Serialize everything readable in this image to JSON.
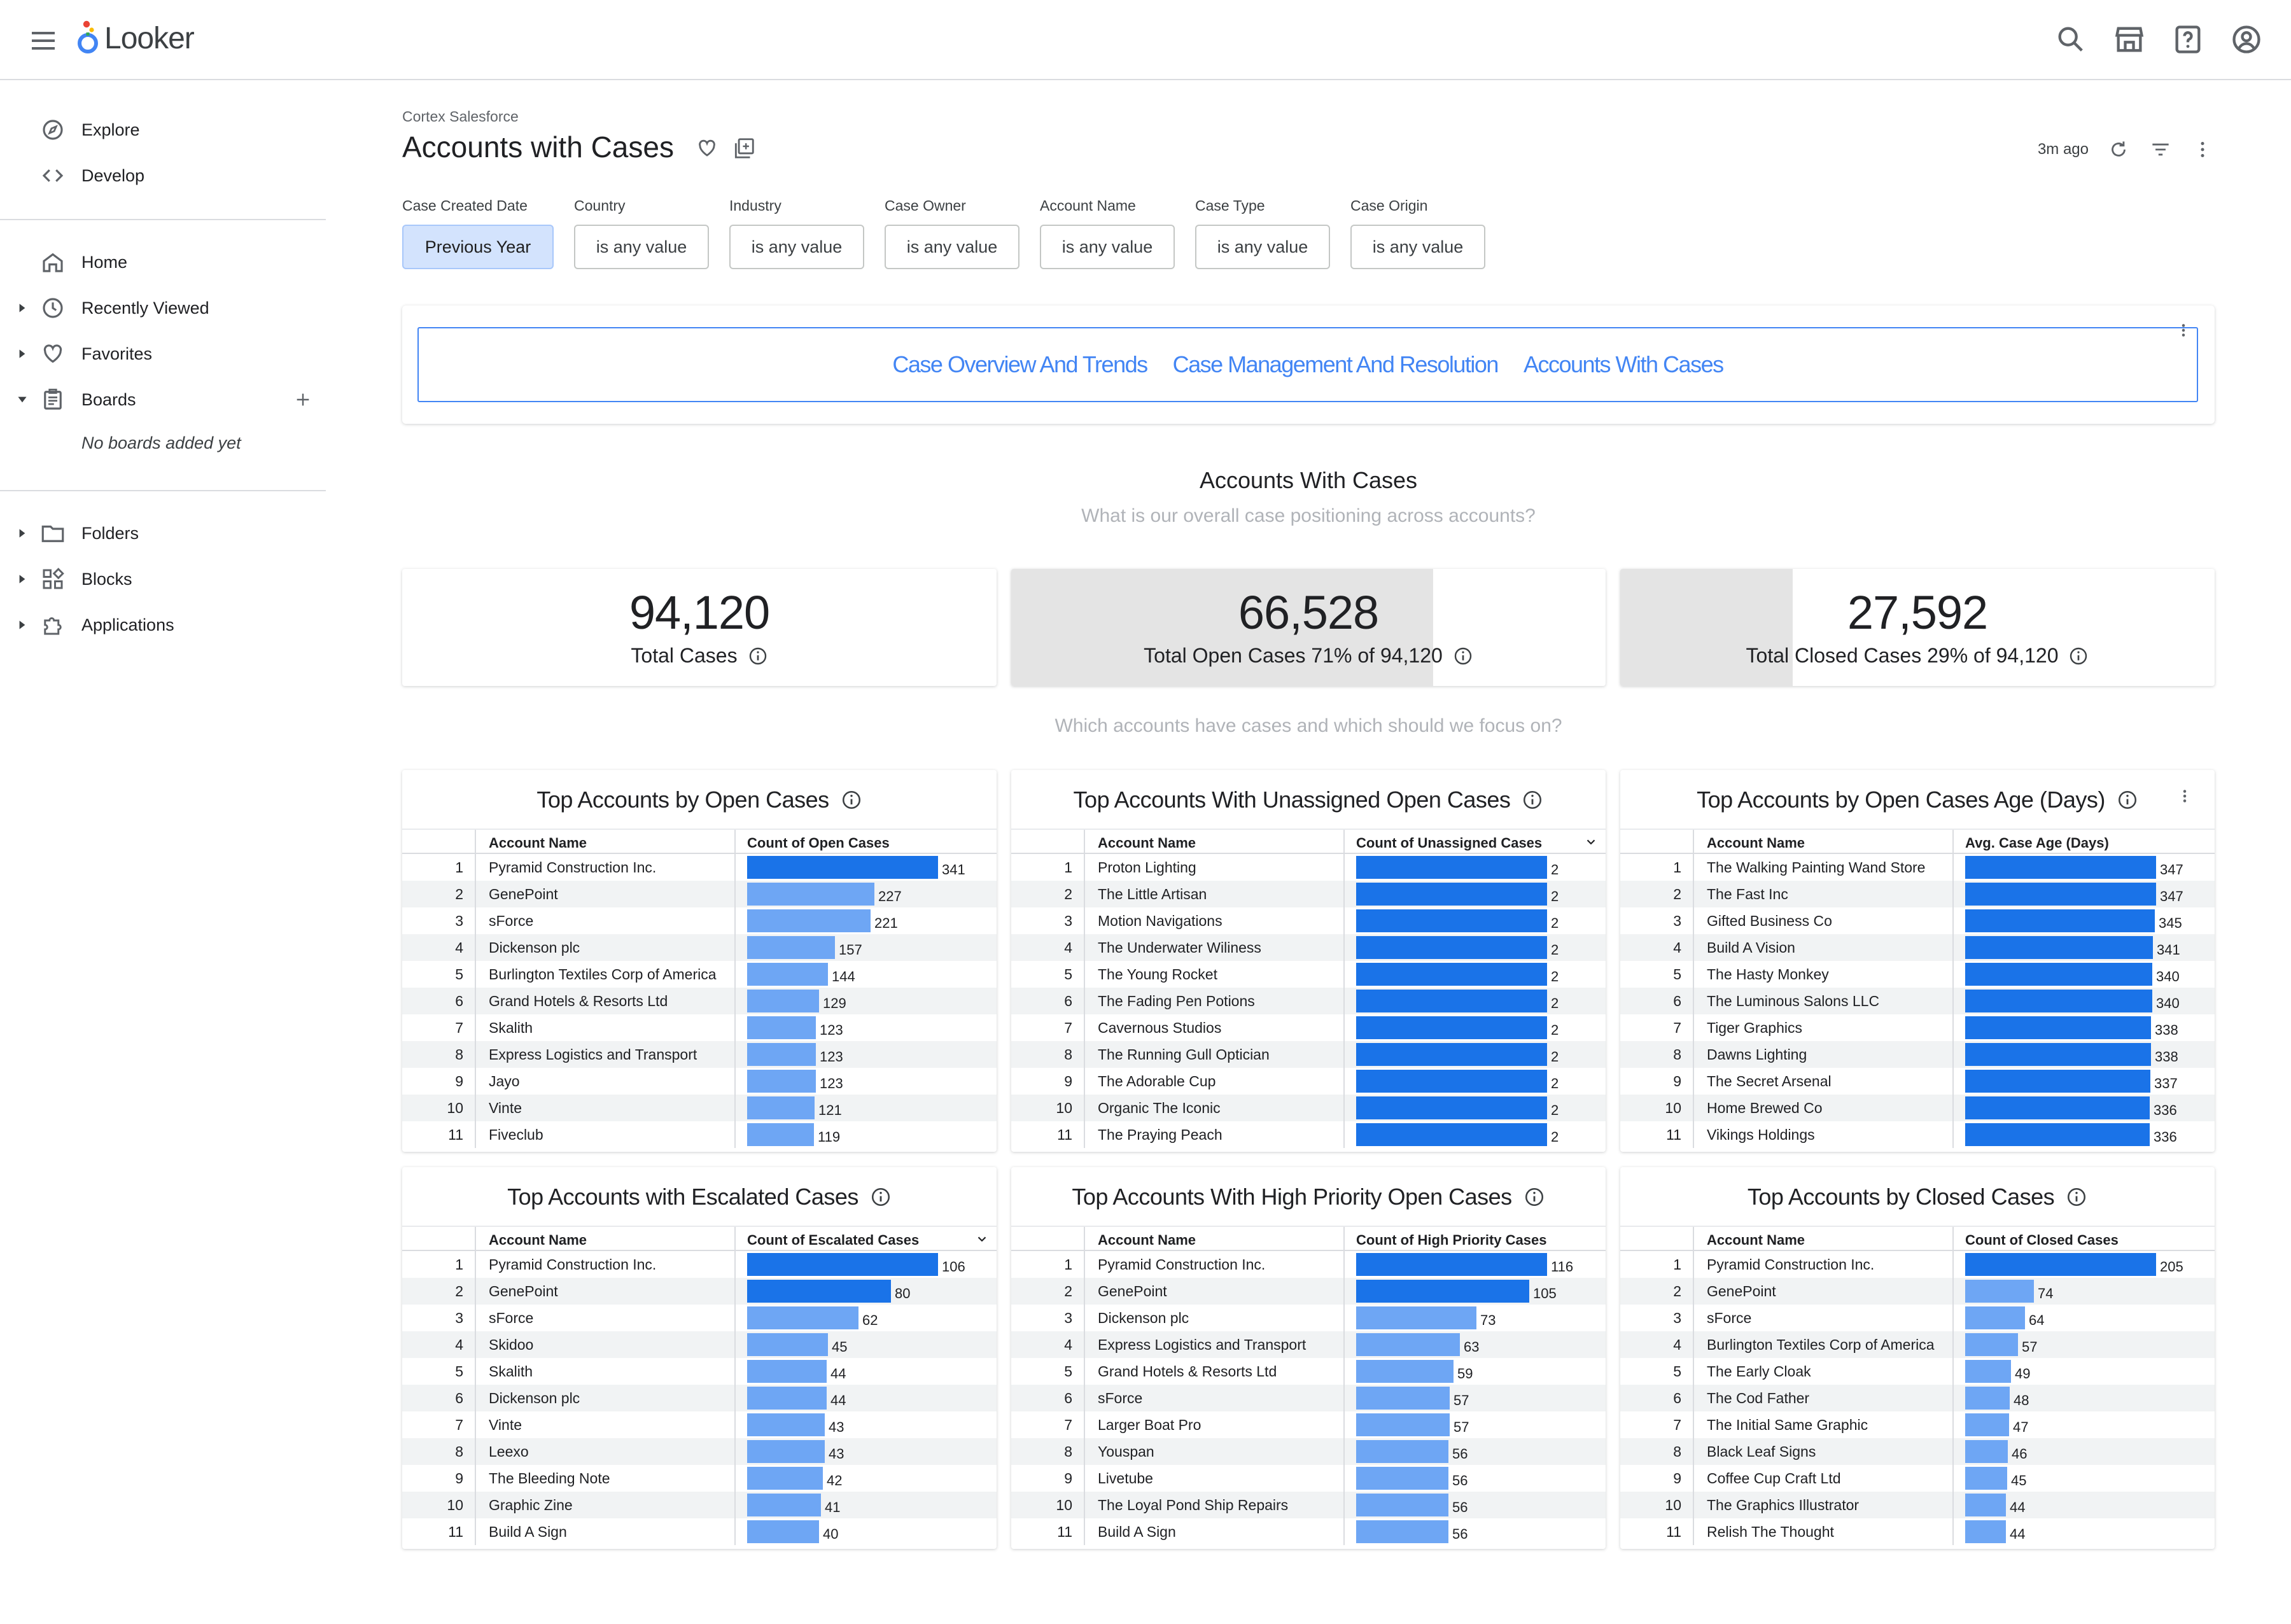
{
  "app": {
    "name": "Looker"
  },
  "colors": {
    "accent": "#4285f4",
    "bar_dark": "#1a73e8",
    "bar_light": "#6ea6f4",
    "kpi_fill": "#e4e4e4",
    "filter_active": "#d3e3fd"
  },
  "sidebar": {
    "primary": [
      {
        "label": "Explore",
        "icon": "compass-icon"
      },
      {
        "label": "Develop",
        "icon": "code-icon"
      }
    ],
    "secondary": [
      {
        "label": "Home",
        "icon": "home-icon",
        "caret": false
      },
      {
        "label": "Recently Viewed",
        "icon": "clock-icon",
        "caret": true
      },
      {
        "label": "Favorites",
        "icon": "heart-icon",
        "caret": true
      },
      {
        "label": "Boards",
        "icon": "board-icon",
        "caret": true,
        "expanded": true
      }
    ],
    "no_boards": "No boards added yet",
    "tertiary": [
      {
        "label": "Folders",
        "icon": "folder-icon"
      },
      {
        "label": "Blocks",
        "icon": "blocks-icon"
      },
      {
        "label": "Applications",
        "icon": "puzzle-icon"
      }
    ]
  },
  "header": {
    "breadcrumb": "Cortex Salesforce",
    "title": "Accounts with Cases",
    "updated": "3m ago"
  },
  "filters": [
    {
      "label": "Case Created Date",
      "value": "Previous Year",
      "active": true
    },
    {
      "label": "Country",
      "value": "is any value"
    },
    {
      "label": "Industry",
      "value": "is any value"
    },
    {
      "label": "Case Owner",
      "value": "is any value"
    },
    {
      "label": "Account Name",
      "value": "is any value"
    },
    {
      "label": "Case Type",
      "value": "is any value"
    },
    {
      "label": "Case Origin",
      "value": "is any value"
    }
  ],
  "nav_tabs": [
    "Case Overview And Trends",
    "Case Management And Resolution",
    "Accounts With Cases"
  ],
  "section1": {
    "title": "Accounts With Cases",
    "subtitle": "What is our overall case positioning across accounts?"
  },
  "section2": {
    "subtitle": "Which accounts have cases and which should we focus on?"
  },
  "kpis": [
    {
      "value": "94,120",
      "label": "Total Cases",
      "fill": 0
    },
    {
      "value": "66,528",
      "label": "Total Open Cases 71% of 94,120",
      "fill": 0.71
    },
    {
      "value": "27,592",
      "label": "Total Closed Cases 29% of 94,120",
      "fill": 0.29
    }
  ],
  "tiles": [
    {
      "title": "Top Accounts by Open Cases",
      "col_account": "Account Name",
      "col_value": "Count of Open Cases",
      "max": 341,
      "sort": false,
      "kebab": false,
      "rows": [
        [
          "Pyramid Construction Inc.",
          341
        ],
        [
          "GenePoint",
          227
        ],
        [
          "sForce",
          221
        ],
        [
          "Dickenson plc",
          157
        ],
        [
          "Burlington Textiles Corp of America",
          144
        ],
        [
          "Grand Hotels & Resorts Ltd",
          129
        ],
        [
          "Skalith",
          123
        ],
        [
          "Express Logistics and Transport",
          123
        ],
        [
          "Jayo",
          123
        ],
        [
          "Vinte",
          121
        ],
        [
          "Fiveclub",
          119
        ]
      ]
    },
    {
      "title": "Top Accounts With Unassigned Open Cases",
      "col_account": "Account Name",
      "col_value": "Count of Unassigned Cases",
      "max": 2,
      "sort": true,
      "kebab": false,
      "rows": [
        [
          "Proton Lighting",
          2
        ],
        [
          "The Little Artisan",
          2
        ],
        [
          "Motion Navigations",
          2
        ],
        [
          "The Underwater Wiliness",
          2
        ],
        [
          "The Young Rocket",
          2
        ],
        [
          "The Fading Pen Potions",
          2
        ],
        [
          "Cavernous Studios",
          2
        ],
        [
          "The Running Gull Optician",
          2
        ],
        [
          "The Adorable Cup",
          2
        ],
        [
          "Organic The Iconic",
          2
        ],
        [
          "The Praying Peach",
          2
        ]
      ]
    },
    {
      "title": "Top Accounts by Open Cases Age (Days)",
      "col_account": "Account Name",
      "col_value": "Avg. Case Age (Days)",
      "max": 347,
      "sort": false,
      "kebab": true,
      "rows": [
        [
          "The Walking Painting Wand Store",
          347
        ],
        [
          "The Fast Inc",
          347
        ],
        [
          "Gifted Business Co",
          345
        ],
        [
          "Build A Vision",
          341
        ],
        [
          "The Hasty Monkey",
          340
        ],
        [
          "The Luminous Salons LLC",
          340
        ],
        [
          "Tiger Graphics",
          338
        ],
        [
          "Dawns Lighting",
          338
        ],
        [
          "The Secret Arsenal",
          337
        ],
        [
          "Home Brewed Co",
          336
        ],
        [
          "Vikings Holdings",
          336
        ]
      ]
    },
    {
      "title": "Top Accounts with Escalated Cases",
      "col_account": "Account Name",
      "col_value": "Count of Escalated Cases",
      "max": 106,
      "sort": true,
      "kebab": false,
      "rows": [
        [
          "Pyramid Construction Inc.",
          106
        ],
        [
          "GenePoint",
          80
        ],
        [
          "sForce",
          62
        ],
        [
          "Skidoo",
          45
        ],
        [
          "Skalith",
          44
        ],
        [
          "Dickenson plc",
          44
        ],
        [
          "Vinte",
          43
        ],
        [
          "Leexo",
          43
        ],
        [
          "The Bleeding Note",
          42
        ],
        [
          "Graphic Zine",
          41
        ],
        [
          "Build A Sign",
          40
        ]
      ]
    },
    {
      "title": "Top Accounts With High Priority Open Cases",
      "col_account": "Account Name",
      "col_value": "Count of High Priority Cases",
      "max": 116,
      "sort": false,
      "kebab": false,
      "rows": [
        [
          "Pyramid Construction Inc.",
          116
        ],
        [
          "GenePoint",
          105
        ],
        [
          "Dickenson plc",
          73
        ],
        [
          "Express Logistics and Transport",
          63
        ],
        [
          "Grand Hotels & Resorts Ltd",
          59
        ],
        [
          "sForce",
          57
        ],
        [
          "Larger Boat Pro",
          57
        ],
        [
          "Youspan",
          56
        ],
        [
          "Livetube",
          56
        ],
        [
          "The Loyal Pond Ship Repairs",
          56
        ],
        [
          "Build A Sign",
          56
        ]
      ]
    },
    {
      "title": "Top Accounts by Closed Cases",
      "col_account": "Account Name",
      "col_value": "Count of Closed Cases",
      "max": 205,
      "sort": false,
      "kebab": false,
      "rows": [
        [
          "Pyramid Construction Inc.",
          205
        ],
        [
          "GenePoint",
          74
        ],
        [
          "sForce",
          64
        ],
        [
          "Burlington Textiles Corp of America",
          57
        ],
        [
          "The Early Cloak",
          49
        ],
        [
          "The Cod Father",
          48
        ],
        [
          "The Initial Same Graphic",
          47
        ],
        [
          "Black Leaf Signs",
          46
        ],
        [
          "Coffee Cup Craft Ltd",
          45
        ],
        [
          "The Graphics Illustrator",
          44
        ],
        [
          "Relish The Thought",
          44
        ]
      ]
    }
  ]
}
